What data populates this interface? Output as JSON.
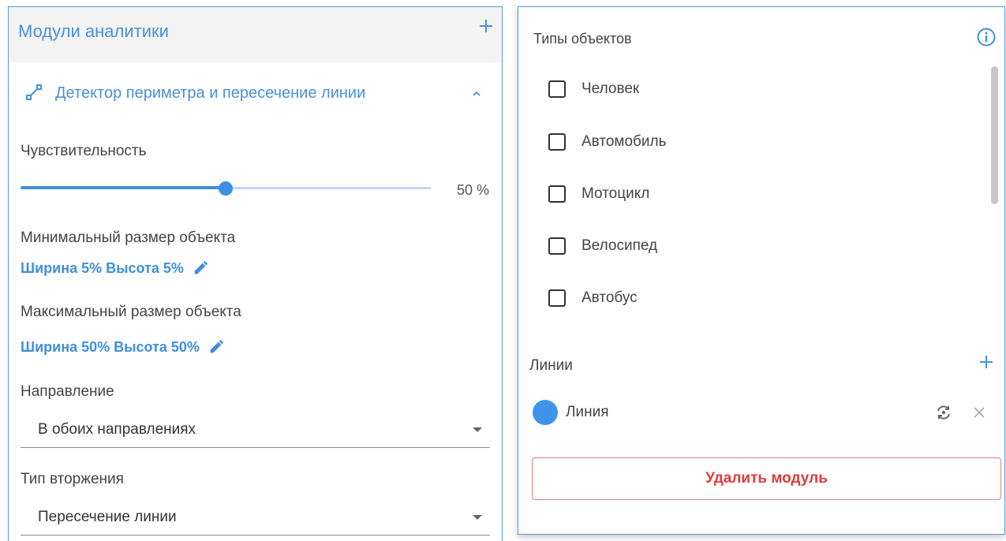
{
  "left_panel": {
    "title": "Модули аналитики",
    "module": {
      "title": "Детектор периметра и пересечение линии",
      "sensitivity_label": "Чувствительность",
      "sensitivity_value": "50 %",
      "sensitivity_percent": 50,
      "min_size_label": "Минимальный размер объекта",
      "min_size_value": "Ширина 5% Высота 5%",
      "max_size_label": "Максимальный размер объекта",
      "max_size_value": "Ширина 50% Высота 50%",
      "direction_label": "Направление",
      "direction_value": "В обоих направлениях",
      "intrusion_label": "Тип вторжения",
      "intrusion_value": "Пересечение линии"
    }
  },
  "right_panel": {
    "object_types_title": "Типы объектов",
    "object_types": [
      {
        "label": "Человек",
        "checked": false
      },
      {
        "label": "Автомобиль",
        "checked": false
      },
      {
        "label": "Мотоцикл",
        "checked": false
      },
      {
        "label": "Велосипед",
        "checked": false
      },
      {
        "label": "Автобус",
        "checked": false
      }
    ],
    "lines_title": "Линии",
    "lines": [
      {
        "label": "Линия",
        "color": "#3f94ea"
      }
    ],
    "delete_button": "Удалить модуль"
  },
  "colors": {
    "accent": "#3f8fe0",
    "danger": "#e23b3b"
  },
  "icons": [
    "add-icon",
    "line-tool-icon",
    "chevron-up-icon",
    "edit-icon",
    "dropdown-arrow-icon",
    "info-icon",
    "swap-direction-icon",
    "close-icon"
  ]
}
